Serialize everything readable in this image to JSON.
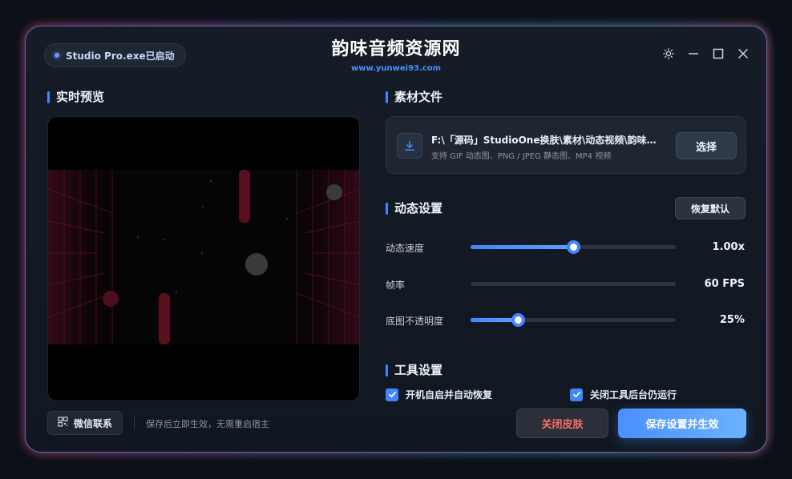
{
  "header": {
    "status": "Studio Pro.exe已启动",
    "title": "韵味音频资源网",
    "subtitle": "www.yunwei93.com",
    "controls": [
      "settings-icon",
      "minimize-icon",
      "maximize-icon",
      "close-icon"
    ]
  },
  "preview": {
    "section_title": "实时预览"
  },
  "footer_left": {
    "wechat_label": "微信联系",
    "hint": "保存后立即生效，无需重启宿主"
  },
  "material": {
    "section_title": "素材文件",
    "path": "F:\\「源码」StudioOne换肤\\素材\\动态视频\\韵味音…",
    "hint": "支持 GIF 动态图、PNG / JPEG 静态图、MP4 视频",
    "choose_label": "选择"
  },
  "motion": {
    "section_title": "动态设置",
    "reset_label": "恢复默认",
    "rows": [
      {
        "label": "动态速度",
        "value": "1.00x",
        "level": 0.5
      },
      {
        "label": "帧率",
        "value": "60 FPS",
        "level": 0
      },
      {
        "label": "底图不透明度",
        "value": "25%",
        "level": 0.23
      }
    ]
  },
  "tools": {
    "section_title": "工具设置",
    "options": [
      {
        "label": "开机自启并自动恢复",
        "checked": true
      },
      {
        "label": "关闭工具后台仍运行",
        "checked": true
      }
    ]
  },
  "actions": {
    "close_skin": "关闭皮肤",
    "save": "保存设置并生效"
  },
  "colors": {
    "accent": "#3f86ff",
    "danger": "#ff6b6b",
    "background": "#111721"
  }
}
